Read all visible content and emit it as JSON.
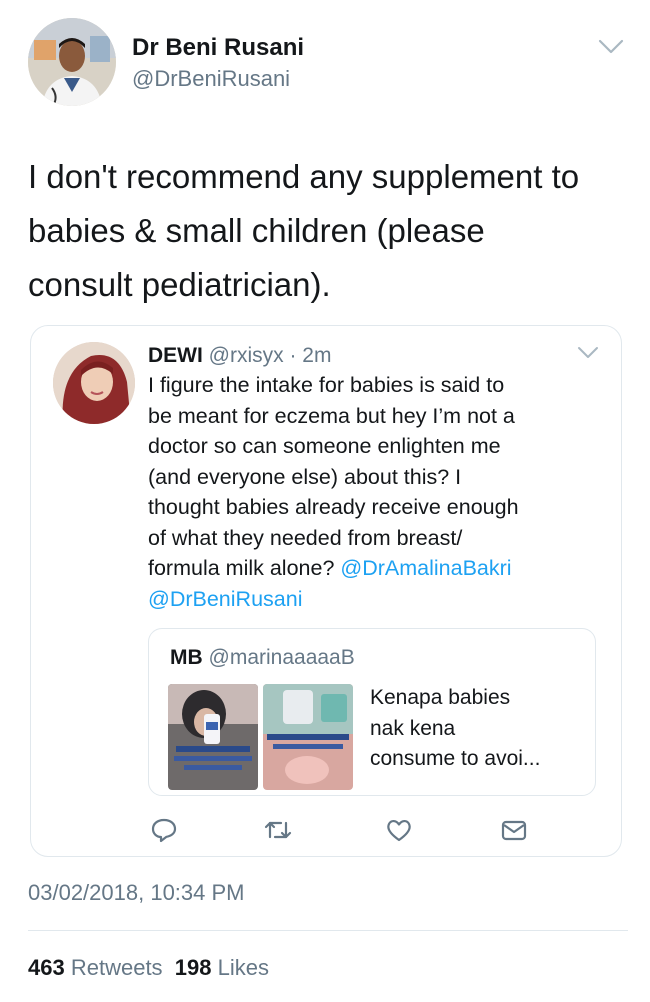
{
  "tweet": {
    "author_name": "Dr Beni Rusani",
    "author_handle": "@DrBeniRusani",
    "text_lines": [
      "I don't recommend any supplement to",
      "babies & small children (please",
      "consult pediatrician)."
    ],
    "timestamp": "03/02/2018, 10:34 PM",
    "retweets_count": "463",
    "retweets_label": "Retweets",
    "likes_count": "198",
    "likes_label": "Likes"
  },
  "quoted": {
    "author_name": "DEWI",
    "meta": "@rxisyx · 2m",
    "text_lines": [
      "I figure the intake for babies is said to",
      "be meant for eczema but hey I’m not a",
      "doctor so can someone enlighten me",
      "(and everyone else) about this? I",
      "thought babies already receive enough",
      "of what they needed from breast/"
    ],
    "last_line_text": "formula milk alone? ",
    "mention_1": "@DrAmalinaBakri",
    "mention_2": "@DrBeniRusani"
  },
  "nested": {
    "author_name": "MB",
    "author_handle": "@marinaaaaaB",
    "text_lines": [
      "Kenapa babies",
      "nak kena",
      "consume to avoi..."
    ]
  },
  "icons": {
    "reply": "reply-icon",
    "retweet": "retweet-icon",
    "like": "heart-icon",
    "dm": "envelope-icon",
    "caret": "chevron-down-icon"
  },
  "colors": {
    "link": "#1da1f2",
    "secondary_text": "#657786",
    "border": "#e1e8ed"
  }
}
